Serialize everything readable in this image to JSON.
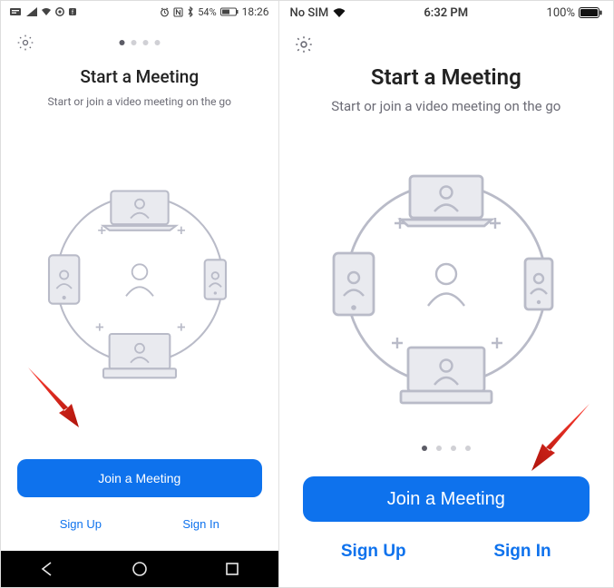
{
  "left": {
    "status": {
      "battery_pct": "54%",
      "time": "18:26"
    },
    "title": "Start a Meeting",
    "subtitle": "Start or join a video meeting on the go",
    "join_label": "Join a Meeting",
    "signup_label": "Sign Up",
    "signin_label": "Sign In"
  },
  "right": {
    "status": {
      "carrier": "No SIM",
      "time": "6:32 PM",
      "battery_pct": "100%"
    },
    "title": "Start a Meeting",
    "subtitle": "Start or join a video meeting on the go",
    "join_label": "Join a Meeting",
    "signup_label": "Sign Up",
    "signin_label": "Sign In"
  }
}
